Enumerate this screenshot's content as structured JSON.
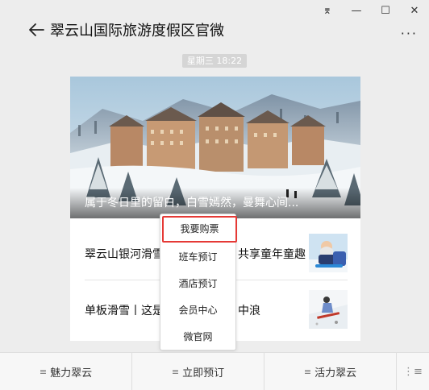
{
  "window": {
    "controls": [
      {
        "name": "pin-icon",
        "glyph": "⌆"
      },
      {
        "name": "minimize-icon",
        "glyph": "—"
      },
      {
        "name": "maximize-icon",
        "glyph": "☐"
      },
      {
        "name": "close-icon",
        "glyph": "✕"
      }
    ]
  },
  "header": {
    "title": "翠云山国际旅游度假区官微",
    "more": "···"
  },
  "chat": {
    "time": "星期三 18:22"
  },
  "card": {
    "hero_caption": "属于冬日里的留白，白雪嫣然，曼舞心间...",
    "articles": [
      {
        "title_left": "翠云山银河滑雪",
        "title_right": "共享童年童趣"
      },
      {
        "title_left": "单板滑雪丨这是",
        "title_right": "中浪"
      }
    ]
  },
  "popup_menu": {
    "items": [
      "我要购票",
      "班车预订",
      "酒店预订",
      "会员中心",
      "微官网"
    ],
    "highlighted_index": 0
  },
  "bottom_menu": {
    "tabs": [
      "魅力翠云",
      "立即预订",
      "活力翠云"
    ],
    "menu_glyph": "≡",
    "keyboard_glyph": "⋮≡"
  },
  "colors": {
    "highlight": "#e53935",
    "background": "#ededed"
  }
}
